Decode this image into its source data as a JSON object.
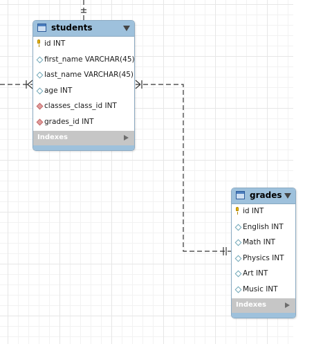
{
  "diagram": {
    "tables": [
      {
        "name": "students",
        "columns": [
          {
            "label": "id INT",
            "kind": "primary-key"
          },
          {
            "label": "first_name VARCHAR(45)",
            "kind": "column"
          },
          {
            "label": "last_name VARCHAR(45)",
            "kind": "column"
          },
          {
            "label": "age INT",
            "kind": "column"
          },
          {
            "label": "classes_class_id INT",
            "kind": "foreign-key"
          },
          {
            "label": "grades_id INT",
            "kind": "foreign-key"
          }
        ],
        "indexes_label": "Indexes"
      },
      {
        "name": "grades",
        "columns": [
          {
            "label": "id INT",
            "kind": "primary-key"
          },
          {
            "label": "English INT",
            "kind": "column"
          },
          {
            "label": "Math INT",
            "kind": "column"
          },
          {
            "label": "Physics INT",
            "kind": "column"
          },
          {
            "label": "Art INT",
            "kind": "column"
          },
          {
            "label": "Music INT",
            "kind": "column"
          }
        ],
        "indexes_label": "Indexes"
      }
    ],
    "relationships": [
      {
        "from": "students",
        "to": "grades",
        "from_cardinality": "many",
        "to_cardinality": "one",
        "style": "dashed"
      },
      {
        "from": "students",
        "to": "offscreen-left",
        "from_cardinality": "many",
        "style": "dashed"
      },
      {
        "from": "students",
        "to": "offscreen-top",
        "from_cardinality": "one",
        "style": "dashed"
      }
    ],
    "colors": {
      "header": "#9ec1dc",
      "footer": "#c6c6c6",
      "foreign_key": "#e09c9c",
      "primary_key": "#e7b200",
      "grid": "#e6e6e6"
    }
  }
}
